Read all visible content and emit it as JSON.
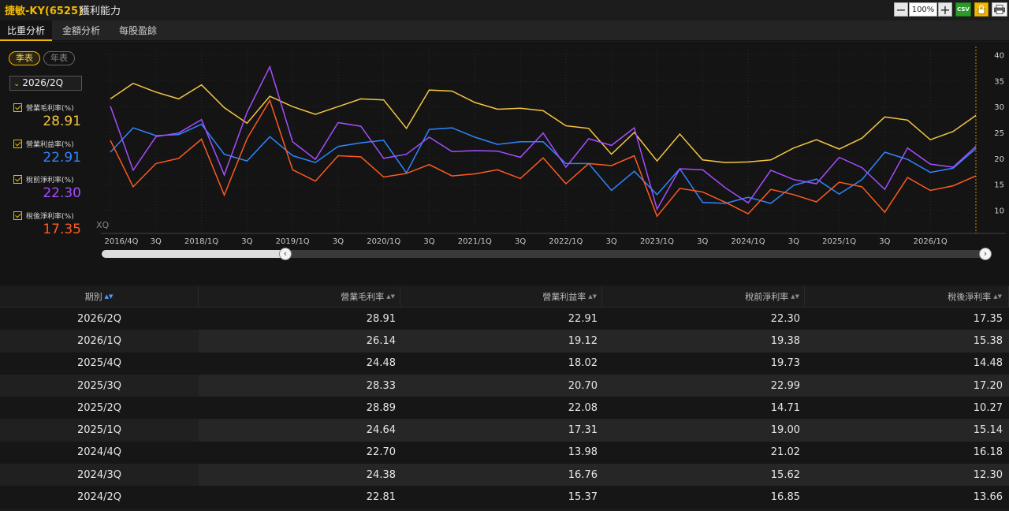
{
  "header": {
    "title": "捷敏-KY(6525)",
    "subtitle": "獲利能力",
    "zoom_minus": "−",
    "zoom_value": "100%",
    "zoom_plus": "+",
    "csv_label": "CSV"
  },
  "tabs": [
    {
      "label": "比重分析",
      "active": true
    },
    {
      "label": "金額分析",
      "active": false
    },
    {
      "label": "每股盈餘",
      "active": false
    }
  ],
  "controls": {
    "quarter_btn": "季表",
    "year_btn": "年表",
    "period_selected": "2026/2Q",
    "chevron": "⌄"
  },
  "legend": [
    {
      "label": "營業毛利率(%)",
      "value": "28.91",
      "color": "#f5c542"
    },
    {
      "label": "營業利益率(%)",
      "value": "22.91",
      "color": "#2e86ff"
    },
    {
      "label": "稅前淨利率(%)",
      "value": "22.30",
      "color": "#a64dff"
    },
    {
      "label": "稅後淨利率(%)",
      "value": "17.35",
      "color": "#ff5a1f"
    }
  ],
  "chart_data": {
    "type": "line",
    "x_tick_labels": [
      "2016/4Q",
      "3Q",
      "2018/1Q",
      "3Q",
      "2019/1Q",
      "3Q",
      "2020/1Q",
      "3Q",
      "2021/1Q",
      "3Q",
      "2022/1Q",
      "3Q",
      "2023/1Q",
      "3Q",
      "2024/1Q",
      "3Q",
      "2025/1Q",
      "3Q",
      "2026/1Q"
    ],
    "y_ticks": [
      10,
      15,
      20,
      25,
      30,
      35,
      40
    ],
    "ylim": [
      5.5,
      41
    ],
    "logo": "XQ",
    "series": [
      {
        "name": "營業毛利率(%)",
        "color": "#f5c542",
        "values": [
          31.5,
          34.5,
          32.8,
          31.5,
          34.2,
          29.8,
          26.8,
          32.0,
          30.0,
          28.5,
          30.0,
          31.5,
          31.3,
          25.8,
          33.2,
          33.0,
          30.8,
          29.5,
          29.7,
          29.2,
          26.3,
          25.8,
          20.8,
          25.0,
          19.5,
          24.7,
          19.7,
          19.2,
          19.3,
          19.7,
          22.0,
          23.6,
          21.8,
          23.9,
          28.0,
          27.4,
          23.6,
          25.2,
          28.3
        ]
      },
      {
        "name": "營業利益率(%)",
        "color": "#2e86ff",
        "values": [
          21.2,
          25.9,
          24.4,
          24.6,
          26.6,
          20.8,
          19.5,
          24.2,
          20.5,
          19.2,
          22.3,
          23.0,
          23.5,
          17.2,
          25.6,
          25.9,
          24.1,
          22.7,
          23.2,
          23.2,
          19.0,
          19.0,
          13.8,
          17.5,
          13.0,
          18.0,
          11.5,
          11.3,
          12.5,
          11.3,
          14.8,
          16.0,
          13.1,
          15.9,
          21.2,
          19.8,
          17.3,
          18.1,
          21.9
        ]
      },
      {
        "name": "稅前淨利率(%)",
        "color": "#a64dff",
        "values": [
          30.1,
          17.7,
          24.2,
          24.9,
          27.5,
          16.8,
          28.9,
          37.7,
          23.2,
          19.8,
          26.9,
          26.2,
          20.0,
          20.8,
          24.1,
          21.3,
          21.5,
          21.4,
          20.2,
          24.9,
          18.3,
          23.8,
          22.5,
          25.9,
          10.2,
          18.0,
          17.8,
          14.3,
          11.4,
          17.7,
          15.9,
          15.1,
          20.2,
          18.2,
          14.0,
          22.0,
          18.9,
          18.3,
          22.3
        ]
      },
      {
        "name": "稅後淨利率(%)",
        "color": "#ff5a1f",
        "values": [
          23.5,
          14.5,
          19.0,
          20.0,
          23.7,
          12.9,
          23.8,
          31.2,
          17.8,
          15.6,
          20.5,
          20.3,
          16.4,
          17.1,
          18.8,
          16.6,
          17.0,
          17.8,
          16.1,
          20.1,
          15.1,
          19.0,
          18.6,
          20.5,
          8.8,
          14.2,
          13.5,
          11.5,
          9.3,
          14.0,
          13.0,
          11.6,
          15.4,
          14.5,
          9.6,
          16.3,
          13.8,
          14.7,
          16.6
        ]
      }
    ]
  },
  "table": {
    "headers": [
      "期別",
      "營業毛利率",
      "營業利益率",
      "稅前淨利率",
      "稅後淨利率"
    ],
    "rows": [
      [
        "2026/2Q",
        "28.91",
        "22.91",
        "22.30",
        "17.35"
      ],
      [
        "2026/1Q",
        "26.14",
        "19.12",
        "19.38",
        "15.38"
      ],
      [
        "2025/4Q",
        "24.48",
        "18.02",
        "19.73",
        "14.48"
      ],
      [
        "2025/3Q",
        "28.33",
        "20.70",
        "22.99",
        "17.20"
      ],
      [
        "2025/2Q",
        "28.89",
        "22.08",
        "14.71",
        "10.27"
      ],
      [
        "2025/1Q",
        "24.64",
        "17.31",
        "19.00",
        "15.14"
      ],
      [
        "2024/4Q",
        "22.70",
        "13.98",
        "21.02",
        "16.18"
      ],
      [
        "2024/3Q",
        "24.38",
        "16.76",
        "15.62",
        "12.30"
      ],
      [
        "2024/2Q",
        "22.81",
        "15.37",
        "16.85",
        "13.66"
      ]
    ]
  }
}
